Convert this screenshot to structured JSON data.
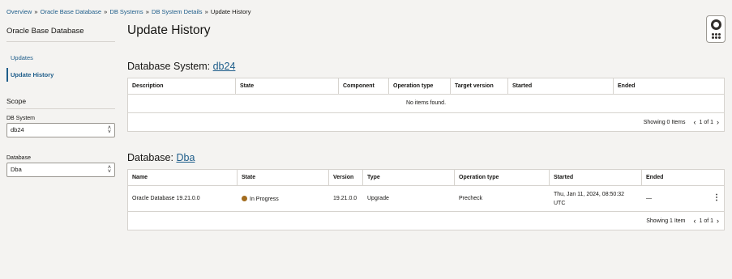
{
  "breadcrumb": [
    "Overview",
    "Oracle Base Database",
    "DB Systems",
    "DB System Details",
    "Update History"
  ],
  "sidebar": {
    "title": "Oracle Base Database",
    "links": [
      {
        "label": "Updates"
      },
      {
        "label": "Update History"
      }
    ],
    "scope_label": "Scope",
    "db_system_label": "DB System",
    "db_system_value": "db24",
    "database_label": "Database",
    "database_value": "Dba"
  },
  "page_title": "Update History",
  "db_system_section": {
    "prefix": "Database System: ",
    "link": "db24",
    "columns": [
      "Description",
      "State",
      "Component",
      "Operation type",
      "Target version",
      "Started",
      "Ended"
    ],
    "empty_text": "No items found.",
    "footer_count": "Showing 0 Items",
    "page": "1 of 1"
  },
  "database_section": {
    "prefix": "Database: ",
    "link": "Dba",
    "columns": [
      "Name",
      "State",
      "Version",
      "Type",
      "Operation type",
      "Started",
      "Ended"
    ],
    "rows": [
      {
        "name": "Oracle Database 19.21.0.0",
        "state": "In Progress",
        "version": "19.21.0.0",
        "type": "Upgrade",
        "operation_type": "Precheck",
        "started_line1": "Thu, Jan 11, 2024, 08:50:32",
        "started_line2": "UTC",
        "ended": "—"
      }
    ],
    "footer_count": "Showing 1 Item",
    "page": "1 of 1"
  },
  "icons": {
    "help": "lifebuoy-icon",
    "apps": "grid-dots-icon",
    "prev": "chevron-left-icon",
    "next": "chevron-right-icon",
    "select": "select-chevron-icon",
    "row_actions": "kebab-menu-icon"
  },
  "colors": {
    "link": "#1e5d8a",
    "in_progress": "#a36d1f"
  }
}
